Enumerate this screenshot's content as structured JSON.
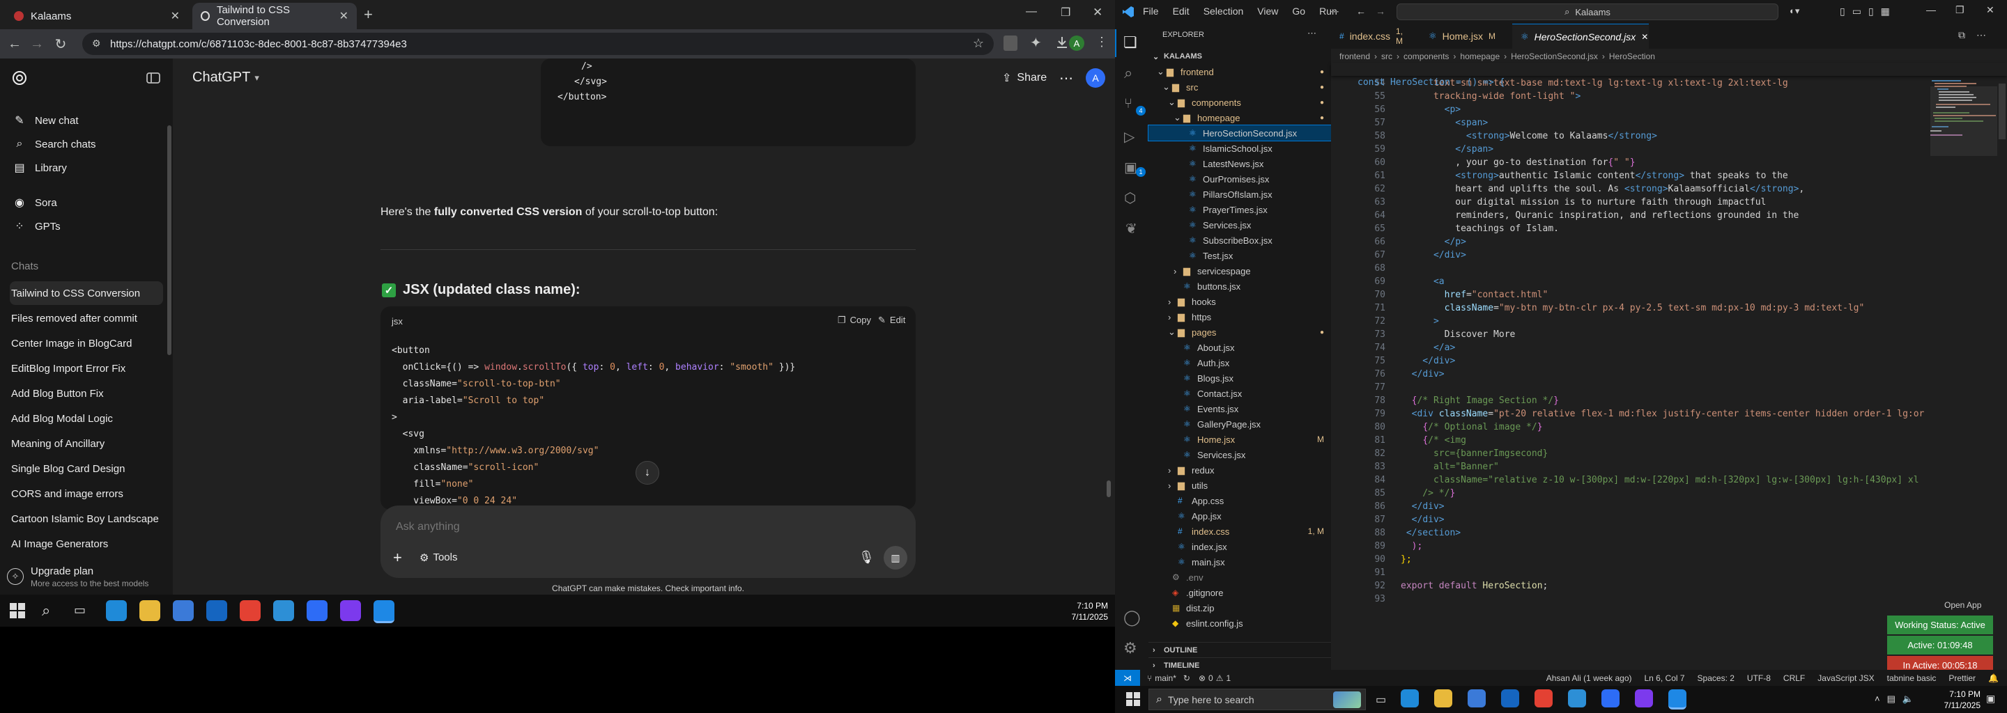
{
  "browser": {
    "tabs": [
      {
        "label": "Kalaams",
        "active": false
      },
      {
        "label": "Tailwind to CSS Conversion",
        "active": true
      }
    ],
    "url": "https://chatgpt.com/c/6871103c-8dec-8001-8c87-8b37477394e3"
  },
  "chatgpt": {
    "app_title": "ChatGPT",
    "share_label": "Share",
    "avatar_letter": "A",
    "nav": [
      {
        "label": "New chat",
        "icon": "new-chat-icon"
      },
      {
        "label": "Search chats",
        "icon": "search-icon"
      },
      {
        "label": "Library",
        "icon": "library-icon"
      },
      {
        "label": "Sora",
        "icon": "sora-icon"
      },
      {
        "label": "GPTs",
        "icon": "gpts-icon"
      }
    ],
    "chats_heading": "Chats",
    "chats": [
      "Tailwind to CSS Conversion",
      "Files removed after commit",
      "Center Image in BlogCard",
      "EditBlog Import Error Fix",
      "Add Blog Button Fix",
      "Add Blog Modal Logic",
      "Meaning of Ancillary",
      "Single Blog Card Design",
      "CORS and image errors",
      "Cartoon Islamic Boy Landscape",
      "AI Image Generators"
    ],
    "upgrade": {
      "title": "Upgrade plan",
      "subtitle": "More access to the best models"
    },
    "prev_code_tail": [
      "/>",
      "</svg>",
      "</button>"
    ],
    "intro_prefix": "Here's the ",
    "intro_bold": "fully converted CSS version",
    "intro_suffix": " of your scroll-to-top button:",
    "section_heading": "JSX (updated class name):",
    "code_lang": "jsx",
    "copy_label": "Copy",
    "edit_label": "Edit",
    "code_lines": [
      "<button",
      "  onClick={() => window.scrollTo({ top: 0, left: 0, behavior: \"smooth\" })}",
      "  className=\"scroll-to-top-btn\"",
      "  aria-label=\"Scroll to top\"",
      ">",
      "  <svg",
      "    xmlns=\"http://www.w3.org/2000/svg\"",
      "    className=\"scroll-icon\"",
      "    fill=\"none\"",
      "    viewBox=\"0 0 24 24\""
    ],
    "composer_placeholder": "Ask anything",
    "tools_label": "Tools",
    "disclaimer": "ChatGPT can make mistakes. Check important info."
  },
  "taskbar_left": {
    "time": "7:10 PM",
    "date": "7/11/2025"
  },
  "vscode": {
    "menu": [
      "File",
      "Edit",
      "Selection",
      "View",
      "Go",
      "Run"
    ],
    "search_text": "Kalaams",
    "explorer_title": "EXPLORER",
    "project": "KALAAMS",
    "tree": [
      {
        "label": "frontend",
        "type": "folder",
        "depth": 1,
        "open": true,
        "dot": true,
        "color": "#e2c08d"
      },
      {
        "label": "src",
        "type": "folder",
        "depth": 2,
        "open": true,
        "dot": true,
        "color": "#e2c08d"
      },
      {
        "label": "components",
        "type": "folder",
        "depth": 3,
        "open": true,
        "dot": true,
        "color": "#e2c08d"
      },
      {
        "label": "homepage",
        "type": "folder",
        "depth": 4,
        "open": true,
        "dot": true,
        "color": "#e2c08d"
      },
      {
        "label": "HeroSectionSecond.jsx",
        "type": "jsx",
        "depth": 5,
        "selected": true,
        "color": "#cccccc"
      },
      {
        "label": "IslamicSchool.jsx",
        "type": "jsx",
        "depth": 5,
        "color": "#cccccc"
      },
      {
        "label": "LatestNews.jsx",
        "type": "jsx",
        "depth": 5,
        "color": "#cccccc"
      },
      {
        "label": "OurPromises.jsx",
        "type": "jsx",
        "depth": 5,
        "color": "#cccccc"
      },
      {
        "label": "PillarsOfIslam.jsx",
        "type": "jsx",
        "depth": 5,
        "color": "#cccccc"
      },
      {
        "label": "PrayerTimes.jsx",
        "type": "jsx",
        "depth": 5,
        "color": "#cccccc"
      },
      {
        "label": "Services.jsx",
        "type": "jsx",
        "depth": 5,
        "color": "#cccccc"
      },
      {
        "label": "SubscribeBox.jsx",
        "type": "jsx",
        "depth": 5,
        "color": "#cccccc"
      },
      {
        "label": "Test.jsx",
        "type": "jsx",
        "depth": 5,
        "color": "#cccccc"
      },
      {
        "label": "servicespage",
        "type": "folder",
        "depth": 4,
        "open": false,
        "color": "#cccccc"
      },
      {
        "label": "buttons.jsx",
        "type": "jsx",
        "depth": 4,
        "color": "#cccccc"
      },
      {
        "label": "hooks",
        "type": "folder",
        "depth": 3,
        "open": false,
        "color": "#cccccc"
      },
      {
        "label": "https",
        "type": "folder",
        "depth": 3,
        "open": false,
        "color": "#cccccc"
      },
      {
        "label": "pages",
        "type": "folder",
        "depth": 3,
        "open": true,
        "dot": true,
        "color": "#e2c08d"
      },
      {
        "label": "About.jsx",
        "type": "jsx",
        "depth": 4,
        "color": "#cccccc"
      },
      {
        "label": "Auth.jsx",
        "type": "jsx",
        "depth": 4,
        "color": "#cccccc"
      },
      {
        "label": "Blogs.jsx",
        "type": "jsx",
        "depth": 4,
        "color": "#cccccc"
      },
      {
        "label": "Contact.jsx",
        "type": "jsx",
        "depth": 4,
        "color": "#cccccc"
      },
      {
        "label": "Events.jsx",
        "type": "jsx",
        "depth": 4,
        "color": "#cccccc"
      },
      {
        "label": "GalleryPage.jsx",
        "type": "jsx",
        "depth": 4,
        "color": "#cccccc"
      },
      {
        "label": "Home.jsx",
        "type": "jsx",
        "depth": 4,
        "badge": "M",
        "color": "#e2c08d"
      },
      {
        "label": "Services.jsx",
        "type": "jsx",
        "depth": 4,
        "color": "#cccccc"
      },
      {
        "label": "redux",
        "type": "folder",
        "depth": 3,
        "open": false,
        "color": "#cccccc"
      },
      {
        "label": "utils",
        "type": "folder",
        "depth": 3,
        "open": false,
        "color": "#cccccc"
      },
      {
        "label": "App.css",
        "type": "css",
        "depth": 3,
        "color": "#cccccc"
      },
      {
        "label": "App.jsx",
        "type": "jsx",
        "depth": 3,
        "color": "#cccccc"
      },
      {
        "label": "index.css",
        "type": "css",
        "depth": 3,
        "badge": "1, M",
        "color": "#e2c08d"
      },
      {
        "label": "index.jsx",
        "type": "jsx",
        "depth": 3,
        "color": "#cccccc"
      },
      {
        "label": "main.jsx",
        "type": "jsx",
        "depth": 3,
        "color": "#cccccc"
      },
      {
        "label": ".env",
        "type": "env",
        "depth": 2,
        "color": "#8b8b8b"
      },
      {
        "label": ".gitignore",
        "type": "git",
        "depth": 2,
        "color": "#cccccc"
      },
      {
        "label": "dist.zip",
        "type": "zip",
        "depth": 2,
        "color": "#cccccc"
      },
      {
        "label": "eslint.config.js",
        "type": "js",
        "depth": 2,
        "color": "#cccccc"
      }
    ],
    "outline_label": "OUTLINE",
    "timeline_label": "TIMELINE",
    "tabs": [
      {
        "label": "index.css",
        "badge": "1, M",
        "active": false
      },
      {
        "label": "Home.jsx",
        "badge": "M",
        "active": false
      },
      {
        "label": "HeroSectionSecond.jsx",
        "badge": "",
        "active": true
      }
    ],
    "breadcrumb": [
      "frontend",
      "src",
      "components",
      "homepage",
      "HeroSectionSecond.jsx",
      "HeroSection"
    ],
    "sticky_line": "const HeroSection = () => {",
    "first_line": 54,
    "code": [
      [
        [
          "      text-sm sm:text-base md:text-lg lg:text-lg xl:text-lg 2xl:text-lg",
          "c-str"
        ]
      ],
      [
        [
          "      tracking-wide font-light \"",
          "c-str"
        ],
        [
          ">",
          "c-tag"
        ]
      ],
      [
        [
          "        <",
          "c-tag"
        ],
        [
          "p",
          "c-tag"
        ],
        [
          ">",
          "c-tag"
        ]
      ],
      [
        [
          "          <",
          "c-tag"
        ],
        [
          "span",
          "c-tag"
        ],
        [
          ">",
          "c-tag"
        ]
      ],
      [
        [
          "            <",
          "c-tag"
        ],
        [
          "strong",
          "c-tag"
        ],
        [
          ">",
          "c-tag"
        ],
        [
          "Welcome to Kalaams",
          "c-txt"
        ],
        [
          "</",
          "c-tag"
        ],
        [
          "strong",
          "c-tag"
        ],
        [
          ">",
          "c-tag"
        ]
      ],
      [
        [
          "          </",
          "c-tag"
        ],
        [
          "span",
          "c-tag"
        ],
        [
          ">",
          "c-tag"
        ]
      ],
      [
        [
          "          , your go-to destination for",
          "c-txt"
        ],
        [
          "{",
          "c-br2"
        ],
        [
          "\" \"",
          "c-str"
        ],
        [
          "}",
          "c-br2"
        ]
      ],
      [
        [
          "          <",
          "c-tag"
        ],
        [
          "strong",
          "c-tag"
        ],
        [
          ">",
          "c-tag"
        ],
        [
          "authentic Islamic content",
          "c-txt"
        ],
        [
          "</",
          "c-tag"
        ],
        [
          "strong",
          "c-tag"
        ],
        [
          ">",
          "c-tag"
        ],
        [
          " that speaks to the",
          "c-txt"
        ]
      ],
      [
        [
          "          heart and uplifts the soul. As ",
          "c-txt"
        ],
        [
          "<",
          "c-tag"
        ],
        [
          "strong",
          "c-tag"
        ],
        [
          ">",
          "c-tag"
        ],
        [
          "Kalaamsofficial",
          "c-txt"
        ],
        [
          "</",
          "c-tag"
        ],
        [
          "strong",
          "c-tag"
        ],
        [
          ">",
          "c-tag"
        ],
        [
          ",",
          "c-txt"
        ]
      ],
      [
        [
          "          our digital mission is to nurture faith through impactful",
          "c-txt"
        ]
      ],
      [
        [
          "          reminders, Quranic inspiration, and reflections grounded in the",
          "c-txt"
        ]
      ],
      [
        [
          "          teachings of Islam.",
          "c-txt"
        ]
      ],
      [
        [
          "        </",
          "c-tag"
        ],
        [
          "p",
          "c-tag"
        ],
        [
          ">",
          "c-tag"
        ]
      ],
      [
        [
          "      </",
          "c-tag"
        ],
        [
          "div",
          "c-tag"
        ],
        [
          ">",
          "c-tag"
        ]
      ],
      [
        [
          "",
          "c-txt"
        ]
      ],
      [
        [
          "      <",
          "c-tag"
        ],
        [
          "a",
          "c-tag"
        ]
      ],
      [
        [
          "        ",
          "c-txt"
        ],
        [
          "href",
          "c-attr"
        ],
        [
          "=",
          "c-txt"
        ],
        [
          "\"contact.html\"",
          "c-str"
        ]
      ],
      [
        [
          "        ",
          "c-txt"
        ],
        [
          "className",
          "c-attr"
        ],
        [
          "=",
          "c-txt"
        ],
        [
          "\"my-btn my-btn-clr px-4 py-2.5 text-sm md:px-10 md:py-3 md:text-lg\"",
          "c-str"
        ]
      ],
      [
        [
          "      >",
          "c-tag"
        ]
      ],
      [
        [
          "        Discover More",
          "c-txt"
        ]
      ],
      [
        [
          "      </",
          "c-tag"
        ],
        [
          "a",
          "c-tag"
        ],
        [
          ">",
          "c-tag"
        ]
      ],
      [
        [
          "    </",
          "c-tag"
        ],
        [
          "div",
          "c-tag"
        ],
        [
          ">",
          "c-tag"
        ]
      ],
      [
        [
          "  </",
          "c-tag"
        ],
        [
          "div",
          "c-tag"
        ],
        [
          ">",
          "c-tag"
        ]
      ],
      [
        [
          "",
          "c-txt"
        ]
      ],
      [
        [
          "  ",
          "c-txt"
        ],
        [
          "{",
          "c-br2"
        ],
        [
          "/* Right Image Section */",
          "c-com"
        ],
        [
          "}",
          "c-br2"
        ]
      ],
      [
        [
          "  <",
          "c-tag"
        ],
        [
          "div",
          "c-tag"
        ],
        [
          " ",
          "c-txt"
        ],
        [
          "className",
          "c-attr"
        ],
        [
          "=",
          "c-txt"
        ],
        [
          "\"pt-20 relative flex-1 md:flex justify-center items-center hidden order-1 lg:or",
          "c-str"
        ]
      ],
      [
        [
          "    ",
          "c-txt"
        ],
        [
          "{",
          "c-br2"
        ],
        [
          "/* Optional image */",
          "c-com"
        ],
        [
          "}",
          "c-br2"
        ]
      ],
      [
        [
          "    ",
          "c-txt"
        ],
        [
          "{",
          "c-br2"
        ],
        [
          "/* <img",
          "c-com"
        ]
      ],
      [
        [
          "      src={bannerImgsecond}",
          "c-com"
        ]
      ],
      [
        [
          "      alt=\"Banner\"",
          "c-com"
        ]
      ],
      [
        [
          "      className=\"relative z-10 w-[300px] md:w-[220px] md:h-[320px] lg:w-[300px] lg:h-[430px] xl",
          "c-com"
        ]
      ],
      [
        [
          "    /> */",
          "c-com"
        ],
        [
          "}",
          "c-br2"
        ]
      ],
      [
        [
          "  </",
          "c-tag"
        ],
        [
          "div",
          "c-tag"
        ],
        [
          ">",
          "c-tag"
        ]
      ],
      [
        [
          "  </",
          "c-tag"
        ],
        [
          "div",
          "c-tag"
        ],
        [
          ">",
          "c-tag"
        ]
      ],
      [
        [
          " </",
          "c-tag"
        ],
        [
          "section",
          "c-tag"
        ],
        [
          ">",
          "c-tag"
        ]
      ],
      [
        [
          "  );",
          "c-br2"
        ]
      ],
      [
        [
          "};",
          "c-br"
        ]
      ],
      [
        [
          "",
          "c-txt"
        ]
      ],
      [
        [
          "export",
          "c-kw"
        ],
        [
          " ",
          "c-txt"
        ],
        [
          "default",
          "c-kw"
        ],
        [
          " ",
          "c-txt"
        ],
        [
          "HeroSection",
          "c-fn"
        ],
        [
          ";",
          "c-txt"
        ]
      ],
      [
        [
          "",
          "c-txt"
        ]
      ]
    ],
    "open_app": "Open App",
    "work_badges": [
      {
        "label": "Working Status: Active",
        "color": "#2e8b3e"
      },
      {
        "label": "Active: 01:09:48",
        "color": "#2e8b3e"
      },
      {
        "label": "In Active: 00:05:18",
        "color": "#c0392b"
      }
    ],
    "status": {
      "branch": "main*",
      "problems": "0",
      "warnings": "1",
      "author": "Ahsan Ali (1 week ago)",
      "position": "Ln 6, Col 7",
      "spaces": "Spaces: 2",
      "encoding": "UTF-8",
      "eol": "CRLF",
      "language": "JavaScript JSX",
      "tabnine": "tabnine basic",
      "prettier": "Prettier"
    }
  },
  "taskbar_right": {
    "search_placeholder": "Type here to search",
    "time": "7:10 PM",
    "date": "7/11/2025"
  }
}
